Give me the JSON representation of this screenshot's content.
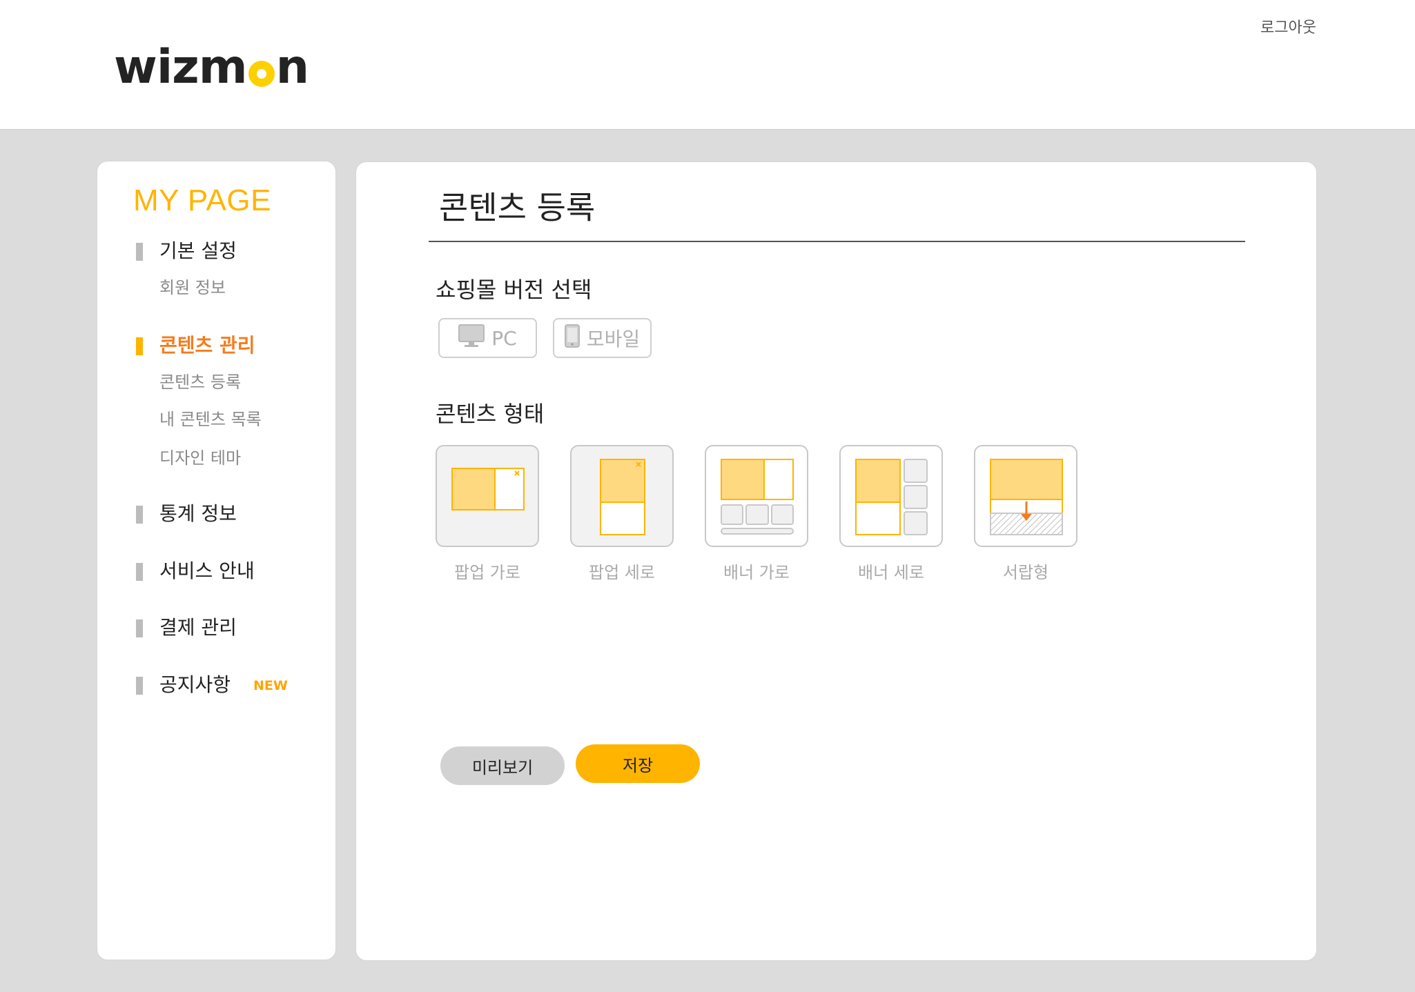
{
  "header": {
    "logo_text_1": "wizm",
    "logo_text_2": "n",
    "logout_label": "로그아웃"
  },
  "sidebar": {
    "title": "MY PAGE",
    "groups": [
      {
        "label": "기본 설정",
        "subs": [
          "회원 정보"
        ]
      },
      {
        "label": "콘텐츠 관리",
        "active": true,
        "subs": [
          "콘텐츠 등록",
          "내 콘텐츠 목록",
          "디자인 테마"
        ]
      },
      {
        "label": "통계 정보",
        "subs": []
      },
      {
        "label": "서비스 안내",
        "subs": []
      },
      {
        "label": "결제 관리",
        "subs": []
      },
      {
        "label": "공지사항",
        "badge": "NEW",
        "subs": []
      }
    ]
  },
  "main": {
    "title": "콘텐츠 등록",
    "version_section": {
      "label": "쇼핑몰 버전 선택",
      "options": [
        {
          "label": "PC",
          "icon": "monitor-icon"
        },
        {
          "label": "모바일",
          "icon": "mobile-icon"
        }
      ]
    },
    "type_section": {
      "label": "콘텐츠 형태",
      "options": [
        {
          "label": "팝업 가로",
          "icon": "popup-horizontal-icon"
        },
        {
          "label": "팝업 세로",
          "icon": "popup-vertical-icon"
        },
        {
          "label": "배너 가로",
          "icon": "banner-horizontal-icon"
        },
        {
          "label": "배너 세로",
          "icon": "banner-vertical-icon"
        },
        {
          "label": "서랍형",
          "icon": "drawer-icon"
        }
      ]
    },
    "buttons": {
      "preview_label": "미리보기",
      "save_label": "저장"
    }
  },
  "colors": {
    "accent": "#ffb400",
    "accent_active": "#f47c1c",
    "layout_fill": "#ffd980",
    "layout_stroke": "#ffb400",
    "background": "#dcdcdc"
  }
}
